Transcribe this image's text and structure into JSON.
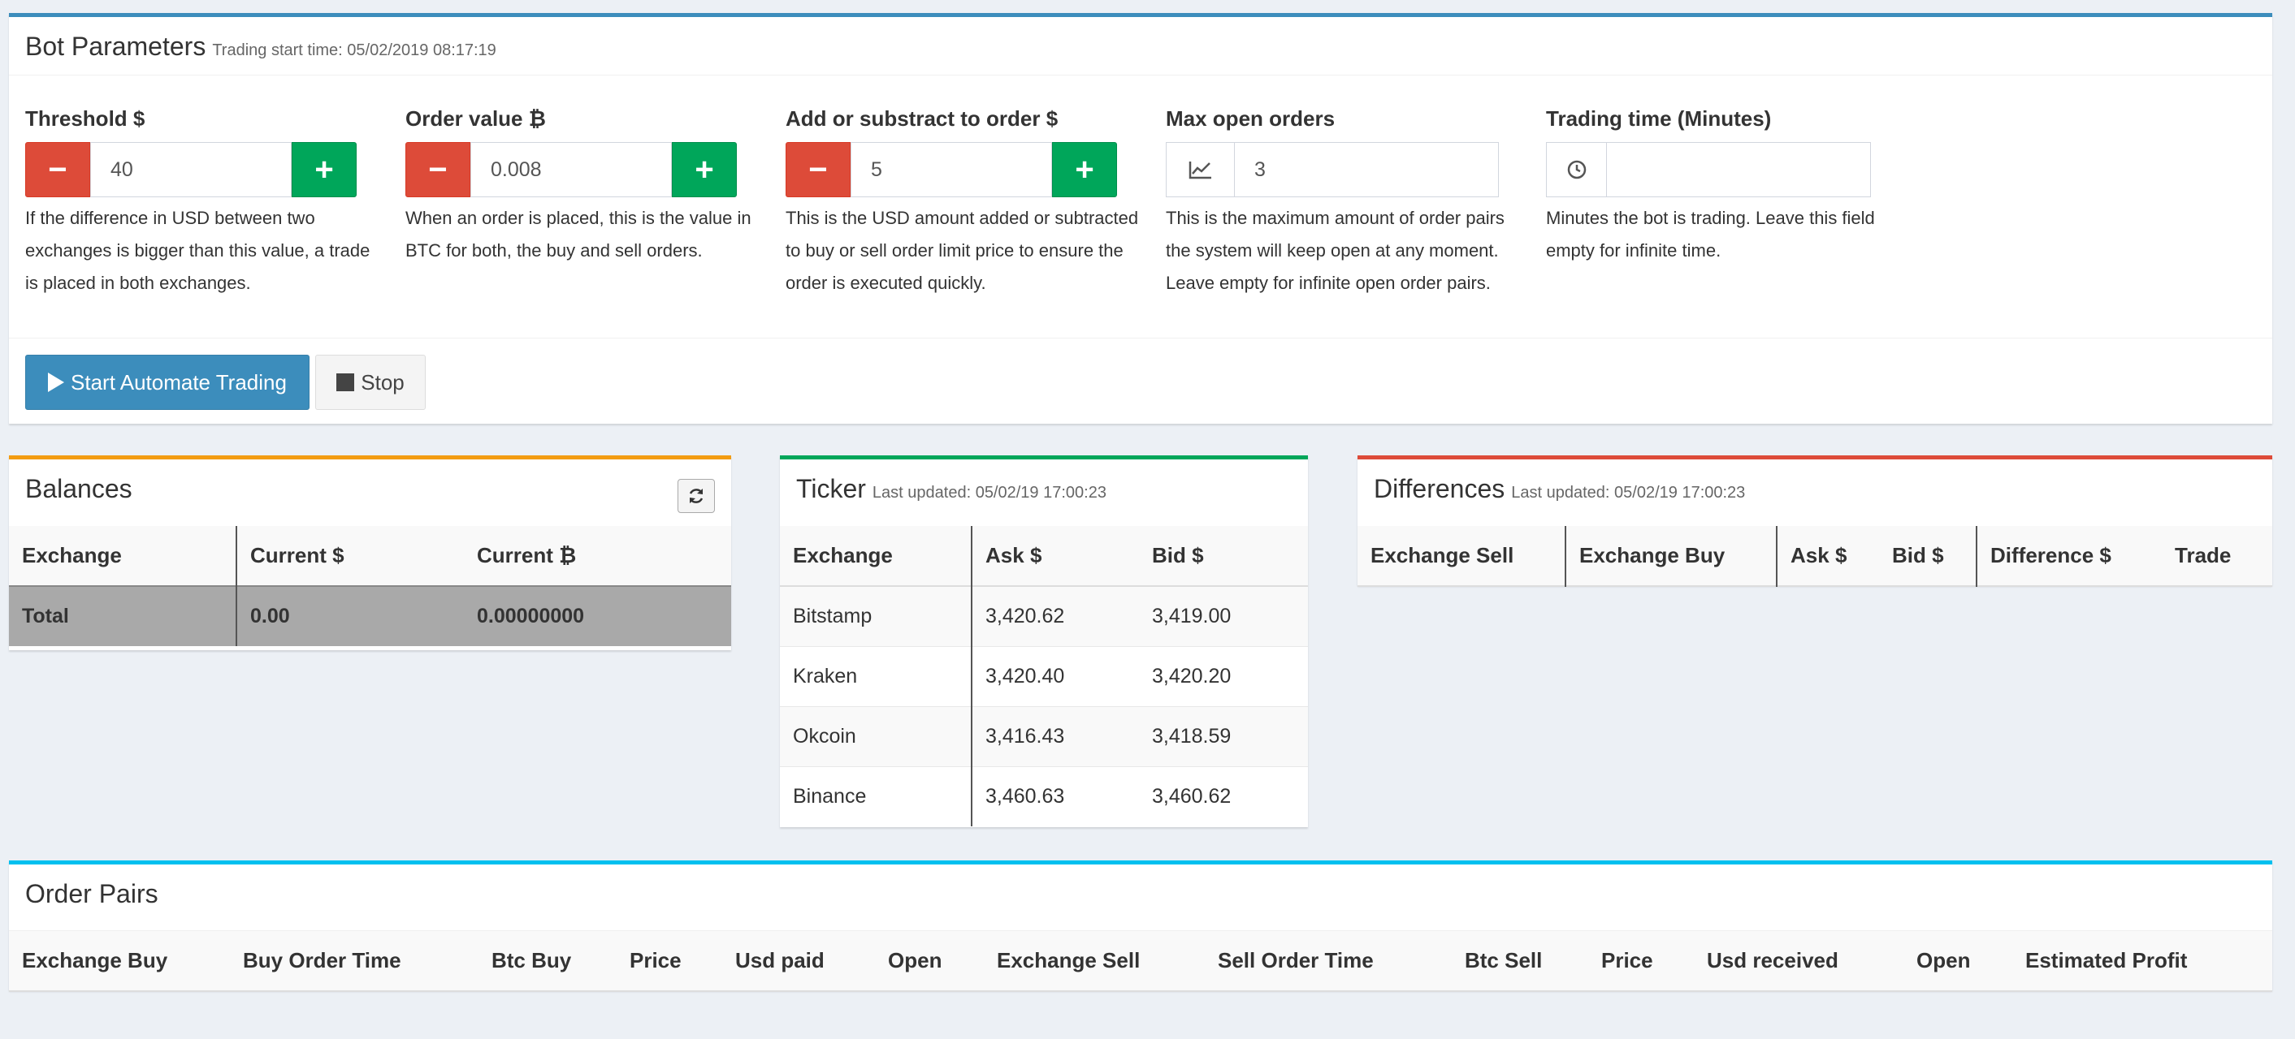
{
  "bot": {
    "title": "Bot Parameters",
    "subtitle": "Trading start time: 05/02/2019 08:17:19",
    "params": [
      {
        "label": "Threshold",
        "unit_icon": "dollar-icon",
        "value": "40",
        "help": "If the difference in USD between two exchanges is bigger than this value, a trade is placed in both exchanges."
      },
      {
        "label": "Order value",
        "unit_icon": "bitcoin-icon",
        "value": "0.008",
        "help": "When an order is placed, this is the value in BTC for both, the buy and sell orders."
      },
      {
        "label": "Add or substract to order",
        "unit_icon": "dollar-icon",
        "value": "5",
        "help": "This is the USD amount added or subtracted to buy or sell order limit price to ensure the order is executed quickly."
      },
      {
        "label": "Max open orders",
        "addon_icon": "line-chart-icon",
        "value": "3",
        "help": "This is the maximum amount of order pairs the system will keep open at any moment. Leave empty for infinite open order pairs."
      },
      {
        "label": "Trading time (Minutes)",
        "addon_icon": "clock-icon",
        "value": "",
        "help": "Minutes the bot is trading. Leave this field empty for infinite time."
      }
    ],
    "start_label": "Start Automate Trading",
    "stop_label": "Stop"
  },
  "balances": {
    "title": "Balances",
    "headers": [
      "Exchange",
      "Current",
      "Current"
    ],
    "header_icons": [
      "",
      "dollar-icon",
      "bitcoin-icon"
    ],
    "total": {
      "exchange": "Total",
      "usd": "0.00",
      "btc": "0.00000000"
    }
  },
  "ticker": {
    "title": "Ticker",
    "subtitle": "Last updated: 05/02/19 17:00:23",
    "headers": [
      "Exchange",
      "Ask",
      "Bid"
    ],
    "rows": [
      {
        "exchange": "Bitstamp",
        "ask": "3,420.62",
        "bid": "3,419.00"
      },
      {
        "exchange": "Kraken",
        "ask": "3,420.40",
        "bid": "3,420.20"
      },
      {
        "exchange": "Okcoin",
        "ask": "3,416.43",
        "bid": "3,418.59"
      },
      {
        "exchange": "Binance",
        "ask": "3,460.63",
        "bid": "3,460.62"
      }
    ]
  },
  "differences": {
    "title": "Differences",
    "subtitle": "Last updated: 05/02/19 17:00:23",
    "headers": [
      "Exchange Sell",
      "Exchange Buy",
      "Ask",
      "Bid",
      "Difference",
      "Trade"
    ]
  },
  "orders": {
    "title": "Order Pairs",
    "headers": [
      "Exchange Buy",
      "Buy Order Time",
      "Btc Buy",
      "Price",
      "Usd paid",
      "Open",
      "Exchange Sell",
      "Sell Order Time",
      "Btc Sell",
      "Price",
      "Usd received",
      "Open",
      "Estimated Profit"
    ]
  },
  "colors": {
    "primary": "#3c8dbc",
    "danger": "#dd4b39",
    "success": "#00a65a",
    "warning": "#f39c12",
    "info": "#00c0ef"
  }
}
